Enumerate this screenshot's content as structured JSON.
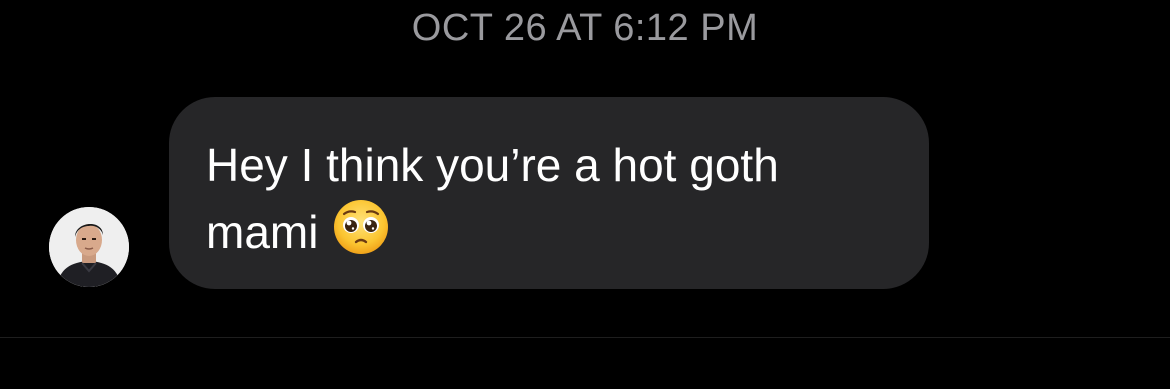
{
  "thread": {
    "timestamp": "OCT 26 AT 6:12 PM"
  },
  "message": {
    "text": "Hey I think you’re a hot goth mami",
    "emoji": "pleading-face-icon",
    "sender": "incoming"
  },
  "colors": {
    "background": "#000000",
    "bubble": "#262628",
    "timestamp": "#9a9a9e",
    "text": "#ffffff"
  }
}
